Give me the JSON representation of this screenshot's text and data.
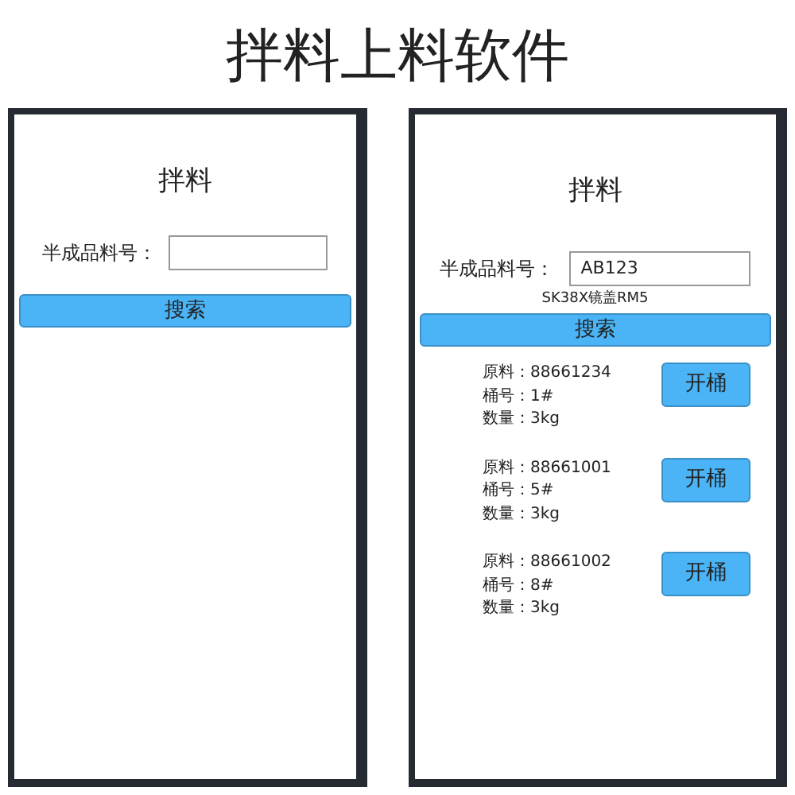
{
  "title": "拌料上料软件",
  "screens": [
    {
      "heading": "拌料",
      "field_label": "半成品料号：",
      "search_button": "搜索"
    },
    {
      "heading": "拌料",
      "field_label": "半成品料号：",
      "field_value": "AB123",
      "hint": "SK38X镜盖RM5",
      "search_button": "搜索",
      "items": [
        {
          "lines": [
            "原料：88661234",
            "桶号：1#",
            "数量：3kg"
          ],
          "button": "开桶"
        },
        {
          "lines": [
            "原料：88661001",
            "桶号：5#",
            "数量：3kg"
          ],
          "button": "开桶"
        },
        {
          "lines": [
            "原料：88661002",
            "桶号：8#",
            "数量：3kg"
          ],
          "button": "开桶"
        }
      ]
    }
  ]
}
